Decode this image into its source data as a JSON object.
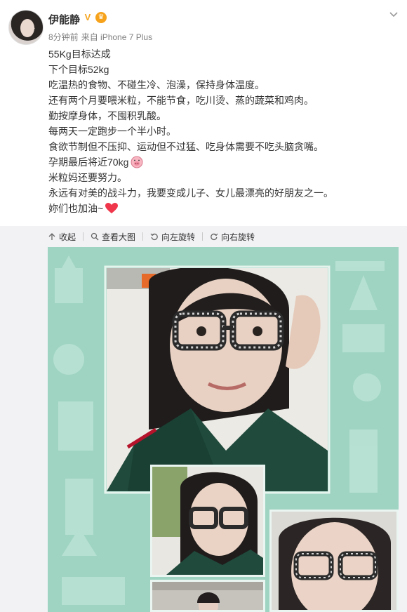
{
  "user": {
    "name": "伊能静",
    "verified_mark": "V",
    "crown_mark": "♛"
  },
  "meta": {
    "time": "8分钟前",
    "source": "来自 iPhone 7 Plus"
  },
  "post": {
    "lines": [
      "55Kg目标达成",
      "下个目标52kg",
      "吃温热的食物、不碰生冷、泡澡，保持身体温度。",
      "还有两个月要喂米粒，不能节食，吃川烫、蒸的蔬菜和鸡肉。",
      "勤按摩身体，不囤积乳酸。",
      "每两天一定跑步一个半小时。",
      "食欲节制但不压抑、运动但不过猛、吃身体需要不吃头脑贪嘴。",
      "孕期最后将近70kg",
      "米粒妈还要努力。",
      "永远有对美的战斗力，我要变成儿子、女儿最漂亮的好朋友之一。",
      "妳们也加油~"
    ]
  },
  "toolbar": {
    "collapse": "收起",
    "view_large": "查看大图",
    "rotate_left": "向左旋转",
    "rotate_right": "向右旋转"
  },
  "icons": {
    "collapse": "collapse-up-icon",
    "view_large": "magnifier-icon",
    "rotate_left": "rotate-left-icon",
    "rotate_right": "rotate-right-icon",
    "menu": "chevron-down-icon",
    "pig": "pig-emoji-icon",
    "heart": "heart-emoji-icon"
  },
  "colors": {
    "link": "#eb7350",
    "text": "#333333",
    "meta": "#808080",
    "toolbar_bg": "#f2f2f5",
    "photo_bg": "#9ad1bf",
    "verified": "#f5a623"
  }
}
